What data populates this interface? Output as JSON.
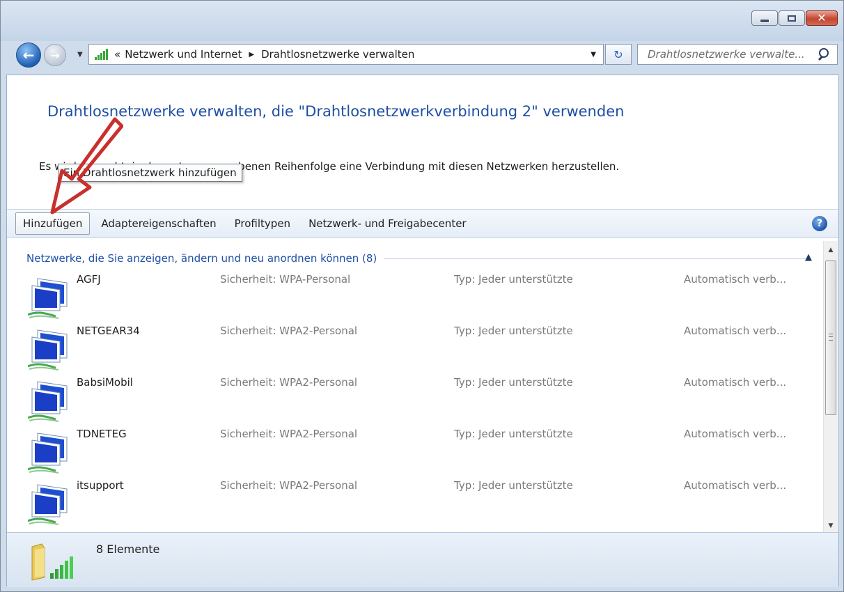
{
  "window": {
    "minimize_label": "minimize",
    "maximize_label": "maximize",
    "close_label": "close"
  },
  "address": {
    "overflow_chevron": "«",
    "crumbs": [
      "Netzwerk und Internet",
      "Drahtlosnetzwerke verwalten"
    ]
  },
  "search": {
    "placeholder": "Drahtlosnetzwerke verwalte..."
  },
  "page": {
    "title": "Drahtlosnetzwerke verwalten, die \"Drahtlosnetzwerkverbindung 2\" verwenden",
    "description": "Es wird versucht, in der unten angegebenen Reihenfolge eine Verbindung mit diesen Netzwerken herzustellen."
  },
  "toolbar": {
    "add": "Hinzufügen",
    "adapter": "Adaptereigenschaften",
    "profile": "Profiltypen",
    "center": "Netzwerk- und Freigabecenter"
  },
  "tooltip": "Ein Drahtlosnetzwerk hinzufügen",
  "group": {
    "header": "Netzwerke, die Sie anzeigen, ändern und neu anordnen können (8)"
  },
  "networks": [
    {
      "name": "AGFJ",
      "security": "Sicherheit: WPA-Personal",
      "type": "Typ: Jeder unterstützte",
      "mode": "Automatisch verb..."
    },
    {
      "name": "NETGEAR34",
      "security": "Sicherheit: WPA2-Personal",
      "type": "Typ: Jeder unterstützte",
      "mode": "Automatisch verb..."
    },
    {
      "name": "BabsiMobil",
      "security": "Sicherheit: WPA2-Personal",
      "type": "Typ: Jeder unterstützte",
      "mode": "Automatisch verb..."
    },
    {
      "name": "TDNETEG",
      "security": "Sicherheit: WPA2-Personal",
      "type": "Typ: Jeder unterstützte",
      "mode": "Automatisch verb..."
    },
    {
      "name": "itsupport",
      "security": "Sicherheit: WPA2-Personal",
      "type": "Typ: Jeder unterstützte",
      "mode": "Automatisch verb..."
    }
  ],
  "status": {
    "count": "8 Elemente"
  },
  "colors": {
    "link_blue": "#1e4fa5",
    "annotation_red": "#c9302c",
    "signal_green": "#36a83b"
  }
}
